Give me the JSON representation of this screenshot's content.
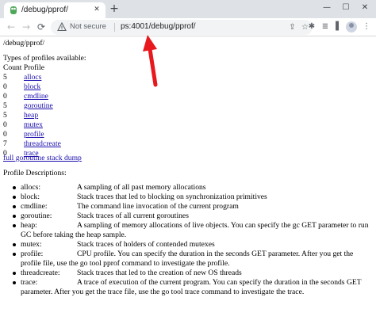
{
  "browser": {
    "tab_title": "/debug/pprof/",
    "tab_close": "✕",
    "new_tab": "+",
    "window_controls": {
      "minimize": "—",
      "maximize": "☐",
      "close": "✕"
    },
    "nav": {
      "back": "←",
      "forward": "→",
      "reload": "⟳"
    },
    "not_secure_label": "Not secure",
    "url": "ps:4001/debug/pprof/",
    "icons": {
      "share": "⇪",
      "bookmark": "☆",
      "extensions": "✱",
      "reading_list": "≣",
      "side_panel": "▌",
      "menu": "⋮"
    }
  },
  "page": {
    "title": "/debug/pprof/",
    "types_heading": "Types of profiles available:",
    "count_heading": "Count Profile",
    "profiles": [
      {
        "count": "5",
        "name": "allocs"
      },
      {
        "count": "0",
        "name": "block"
      },
      {
        "count": "0",
        "name": "cmdline"
      },
      {
        "count": "5",
        "name": "goroutine"
      },
      {
        "count": "5",
        "name": "heap"
      },
      {
        "count": "0",
        "name": "mutex"
      },
      {
        "count": "0",
        "name": "profile"
      },
      {
        "count": "7",
        "name": "threadcreate"
      },
      {
        "count": "0",
        "name": "trace"
      }
    ],
    "full_dump_link": "full goroutine stack dump",
    "descriptions_heading": "Profile Descriptions:",
    "descriptions": [
      {
        "name": "allocs:",
        "text": "A sampling of all past memory allocations"
      },
      {
        "name": "block:",
        "text": "Stack traces that led to blocking on synchronization primitives"
      },
      {
        "name": "cmdline:",
        "text": "The command line invocation of the current program"
      },
      {
        "name": "goroutine:",
        "text": "Stack traces of all current goroutines"
      },
      {
        "name": "heap:",
        "text": "A sampling of memory allocations of live objects. You can specify the gc GET parameter to run GC before taking the heap sample."
      },
      {
        "name": "mutex:",
        "text": "Stack traces of holders of contended mutexes"
      },
      {
        "name": "profile:",
        "text": "CPU profile. You can specify the duration in the seconds GET parameter. After you get the profile file, use the go tool pprof command to investigate the profile."
      },
      {
        "name": "threadcreate:",
        "text": "Stack traces that led to the creation of new OS threads"
      },
      {
        "name": "trace:",
        "text": "A trace of execution of the current program. You can specify the duration in the seconds GET parameter. After you get the trace file, use the go tool trace command to investigate the trace."
      }
    ]
  },
  "colors": {
    "link": "#1a0dab",
    "annotation_arrow": "#e8191e",
    "tab_strip": "#dee1e6",
    "omnibox": "#f1f3f4"
  }
}
